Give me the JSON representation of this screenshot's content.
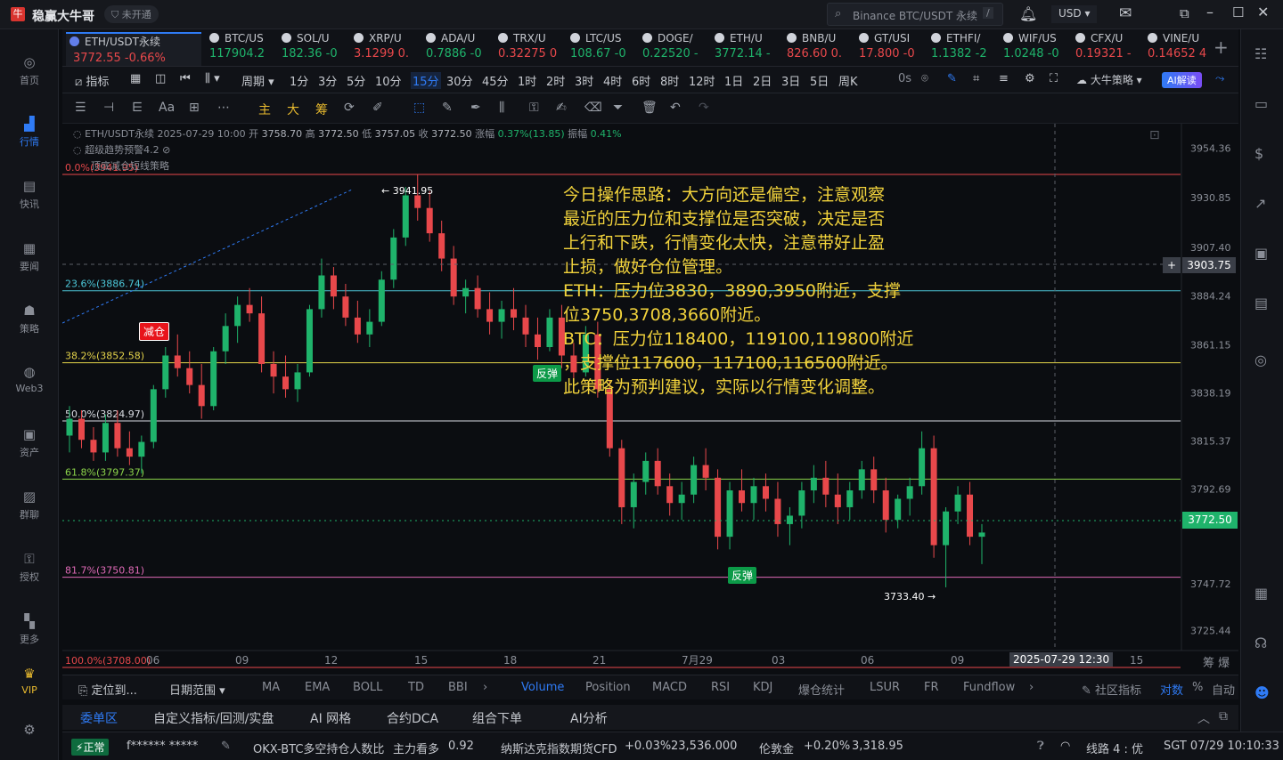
{
  "app": {
    "title": "稳赢大牛哥",
    "badge": "未开通",
    "search_placeholder": "Binance BTC/USDT 永续",
    "search_key": "/",
    "currency": "USD"
  },
  "nav": [
    {
      "label": "首页",
      "icon": "home-icon"
    },
    {
      "label": "行情",
      "icon": "chart-bars-icon"
    },
    {
      "label": "快讯",
      "icon": "news-icon"
    },
    {
      "label": "要闻",
      "icon": "doc-icon"
    },
    {
      "label": "策略",
      "icon": "robot-icon"
    },
    {
      "label": "Web3",
      "icon": "web3-icon"
    },
    {
      "label": "资产",
      "icon": "wallet-icon"
    },
    {
      "label": "群聊",
      "icon": "chat-icon"
    },
    {
      "label": "授权",
      "icon": "key-icon"
    },
    {
      "label": "更多",
      "icon": "grid-icon"
    },
    {
      "label": "VIP",
      "icon": "vip-icon"
    }
  ],
  "tickers": [
    {
      "name": "ETH/USDT永续",
      "price": "3772.55",
      "change": "-0.66%",
      "dir": "red"
    },
    {
      "name": "BTC/US",
      "price": "117904.2",
      "change": "",
      "dir": "green"
    },
    {
      "name": "SOL/U",
      "price": "182.36",
      "change": "-0",
      "dir": "green"
    },
    {
      "name": "XRP/U",
      "price": "3.1299",
      "change": "0.",
      "dir": "red"
    },
    {
      "name": "ADA/U",
      "price": "0.7886",
      "change": "-0",
      "dir": "green"
    },
    {
      "name": "TRX/U",
      "price": "0.32275",
      "change": "0",
      "dir": "red"
    },
    {
      "name": "LTC/US",
      "price": "108.67",
      "change": "-0",
      "dir": "green"
    },
    {
      "name": "DOGE/",
      "price": "0.22520",
      "change": "-",
      "dir": "green"
    },
    {
      "name": "ETH/U",
      "price": "3772.14",
      "change": "-",
      "dir": "green"
    },
    {
      "name": "BNB/U",
      "price": "826.60",
      "change": "0.",
      "dir": "red"
    },
    {
      "name": "GT/USI",
      "price": "17.800",
      "change": "-0",
      "dir": "red"
    },
    {
      "name": "ETHFI/",
      "price": "1.1382",
      "change": "-2",
      "dir": "green"
    },
    {
      "name": "WIF/US",
      "price": "1.0248",
      "change": "-0",
      "dir": "green"
    },
    {
      "name": "CFX/U",
      "price": "0.19321",
      "change": "-",
      "dir": "red"
    },
    {
      "name": "VINE/U",
      "price": "0.14652",
      "change": "4",
      "dir": "red"
    }
  ],
  "timeframes": {
    "indicator": "指标",
    "period": "周期",
    "items": [
      "1分",
      "3分",
      "5分",
      "10分",
      "15分",
      "30分",
      "45分",
      "1时",
      "2时",
      "3时",
      "4时",
      "6时",
      "8时",
      "12时",
      "1日",
      "2日",
      "3日",
      "5日",
      "周K"
    ],
    "active": "15分",
    "zero": "0s",
    "strategy": "大牛策略",
    "ai": "AI解读"
  },
  "draw_tools": [
    "主",
    "大",
    "筹"
  ],
  "legend": {
    "symbol": "ETH/USDT永续",
    "datetime": "2025-07-29 10:00",
    "open_label": "开",
    "open": "3758.70",
    "high_label": "高",
    "high": "3772.50",
    "low_label": "低",
    "low": "3757.05",
    "close_label": "收",
    "close": "3772.50",
    "change_label": "涨幅",
    "change": "0.37%(13.85)",
    "amp_label": "振幅",
    "amp": "0.41%",
    "ind1": "超级趋势预警4.2",
    "ind2": "顶底减仓短线策略"
  },
  "chart_data": {
    "type": "candlestick",
    "y_ticks": [
      "3954.36",
      "3930.85",
      "3907.40",
      "3884.24",
      "3861.15",
      "3838.19",
      "3815.37",
      "3792.69",
      "3772.50",
      "3747.72",
      "3725.44"
    ],
    "x_ticks": [
      "06",
      "09",
      "12",
      "15",
      "18",
      "21",
      "7月29",
      "03",
      "06",
      "09",
      "15"
    ],
    "crosshair_price": "3903.75",
    "crosshair_time": "2025-07-29 12:30",
    "last_price": "3772.50",
    "fib_levels": [
      {
        "label": "0.0%(3941.95)",
        "price": 3941.95,
        "color": "#e8484b"
      },
      {
        "label": "23.6%(3886.74)",
        "price": 3886.74,
        "color": "#4cc7d8"
      },
      {
        "label": "38.2%(3852.58)",
        "price": 3852.58,
        "color": "#e4d34a"
      },
      {
        "label": "50.0%(3824.97)",
        "price": 3824.97,
        "color": "#d9dce2"
      },
      {
        "label": "61.8%(3797.37)",
        "price": 3797.37,
        "color": "#8bd34a"
      },
      {
        "label": "81.7%(3750.81)",
        "price": 3750.81,
        "color": "#e06ab7"
      },
      {
        "label": "100.0%(3708.00)",
        "price": 3708.0,
        "color": "#e8484b"
      }
    ],
    "high_marker": "3941.95",
    "low_marker": "3733.40",
    "signals": [
      {
        "text": "减仓",
        "type": "reduce"
      },
      {
        "text": "反弹",
        "type": "rebound"
      },
      {
        "text": "反弹",
        "type": "rebound"
      }
    ],
    "ylim": [
      3716,
      3966
    ],
    "candles": [
      [
        3818,
        3832,
        3810,
        3826
      ],
      [
        3826,
        3830,
        3812,
        3816
      ],
      [
        3816,
        3822,
        3806,
        3810
      ],
      [
        3810,
        3828,
        3806,
        3824
      ],
      [
        3824,
        3830,
        3808,
        3812
      ],
      [
        3812,
        3820,
        3804,
        3808
      ],
      [
        3808,
        3818,
        3800,
        3815
      ],
      [
        3815,
        3842,
        3812,
        3840
      ],
      [
        3840,
        3860,
        3836,
        3856
      ],
      [
        3856,
        3866,
        3846,
        3850
      ],
      [
        3850,
        3858,
        3838,
        3842
      ],
      [
        3842,
        3852,
        3826,
        3832
      ],
      [
        3832,
        3860,
        3830,
        3858
      ],
      [
        3858,
        3876,
        3852,
        3870
      ],
      [
        3870,
        3884,
        3862,
        3880
      ],
      [
        3880,
        3888,
        3872,
        3876
      ],
      [
        3876,
        3884,
        3848,
        3852
      ],
      [
        3852,
        3858,
        3838,
        3846
      ],
      [
        3846,
        3856,
        3836,
        3840
      ],
      [
        3840,
        3852,
        3834,
        3848
      ],
      [
        3848,
        3880,
        3846,
        3878
      ],
      [
        3878,
        3902,
        3874,
        3894
      ],
      [
        3894,
        3898,
        3878,
        3884
      ],
      [
        3884,
        3890,
        3870,
        3874
      ],
      [
        3874,
        3882,
        3862,
        3866
      ],
      [
        3866,
        3878,
        3860,
        3872
      ],
      [
        3872,
        3896,
        3870,
        3892
      ],
      [
        3892,
        3916,
        3888,
        3912
      ],
      [
        3912,
        3936,
        3908,
        3932
      ],
      [
        3932,
        3942,
        3920,
        3926
      ],
      [
        3926,
        3934,
        3910,
        3914
      ],
      [
        3914,
        3920,
        3896,
        3902
      ],
      [
        3902,
        3908,
        3880,
        3884
      ],
      [
        3884,
        3892,
        3876,
        3888
      ],
      [
        3888,
        3894,
        3874,
        3878
      ],
      [
        3878,
        3886,
        3866,
        3872
      ],
      [
        3872,
        3882,
        3864,
        3878
      ],
      [
        3878,
        3888,
        3868,
        3874
      ],
      [
        3874,
        3880,
        3860,
        3866
      ],
      [
        3866,
        3874,
        3854,
        3860
      ],
      [
        3860,
        3878,
        3858,
        3874
      ],
      [
        3874,
        3880,
        3850,
        3856
      ],
      [
        3856,
        3862,
        3842,
        3848
      ],
      [
        3848,
        3870,
        3846,
        3866
      ],
      [
        3866,
        3872,
        3836,
        3840
      ],
      [
        3840,
        3844,
        3808,
        3812
      ],
      [
        3812,
        3816,
        3776,
        3784
      ],
      [
        3784,
        3800,
        3774,
        3796
      ],
      [
        3796,
        3810,
        3790,
        3806
      ],
      [
        3806,
        3812,
        3790,
        3794
      ],
      [
        3794,
        3800,
        3780,
        3786
      ],
      [
        3786,
        3796,
        3778,
        3790
      ],
      [
        3790,
        3808,
        3786,
        3804
      ],
      [
        3804,
        3812,
        3792,
        3798
      ],
      [
        3798,
        3802,
        3764,
        3770
      ],
      [
        3770,
        3796,
        3764,
        3792
      ],
      [
        3792,
        3802,
        3782,
        3786
      ],
      [
        3786,
        3798,
        3778,
        3794
      ],
      [
        3794,
        3800,
        3782,
        3788
      ],
      [
        3788,
        3796,
        3770,
        3776
      ],
      [
        3776,
        3784,
        3766,
        3780
      ],
      [
        3780,
        3796,
        3774,
        3792
      ],
      [
        3792,
        3804,
        3786,
        3798
      ],
      [
        3798,
        3806,
        3784,
        3790
      ],
      [
        3790,
        3800,
        3776,
        3784
      ],
      [
        3784,
        3796,
        3778,
        3792
      ],
      [
        3792,
        3806,
        3788,
        3802
      ],
      [
        3802,
        3808,
        3786,
        3792
      ],
      [
        3792,
        3798,
        3772,
        3778
      ],
      [
        3778,
        3790,
        3774,
        3788
      ],
      [
        3788,
        3798,
        3780,
        3794
      ],
      [
        3794,
        3820,
        3790,
        3812
      ],
      [
        3812,
        3818,
        3760,
        3766
      ],
      [
        3766,
        3784,
        3746,
        3782
      ],
      [
        3782,
        3794,
        3776,
        3790
      ],
      [
        3790,
        3796,
        3766,
        3770
      ],
      [
        3770,
        3776,
        3757,
        3772
      ]
    ]
  },
  "strategy_text": "今日操作思路：大方向还是偏空，注意观察\n最近的压力位和支撑位是否突破，决定是否\n上行和下跌，行情变化太快，注意带好止盈\n止损，做好仓位管理。\nETH：压力位3830，3890,3950附近，支撑\n位3750,3708,3660附近。\nBTC：压力位118400，119100,119800附近\n，支撑位117600，117100,116500附近。\n此策略为预判建议，实际以行情变化调整。",
  "bottom_tabs": {
    "locate": "定位到...",
    "range": "日期范围",
    "indicators": [
      "MA",
      "EMA",
      "BOLL",
      "TD",
      "BBI"
    ],
    "sub": [
      "Volume",
      "Position",
      "MACD",
      "RSI",
      "KDJ",
      "爆仓统计",
      "LSUR",
      "FR",
      "Fundflow"
    ],
    "active": "Volume",
    "community": "社区指标",
    "log": "对数",
    "pct": "%",
    "auto": "自动",
    "edge": "筹 爆"
  },
  "panel_tabs": [
    "委单区",
    "自定义指标/回测/实盘",
    "AI 网格",
    "合约DCA",
    "组合下单",
    "AI分析"
  ],
  "status": {
    "state": "正常",
    "user": "f****** *****",
    "okx_label": "OKX-BTC多空持仓人数比",
    "okx_tag": "主力看多",
    "okx_value": "0.92",
    "nasdaq_label": "纳斯达克指数期货CFD",
    "nasdaq_change": "+0.03%",
    "nasdaq_value": "23,536.000",
    "gold_label": "伦敦金",
    "gold_change": "+0.20%",
    "gold_value": "3,318.95",
    "line": "线路 4 : 优",
    "time": "SGT 07/29 10:10:33"
  }
}
